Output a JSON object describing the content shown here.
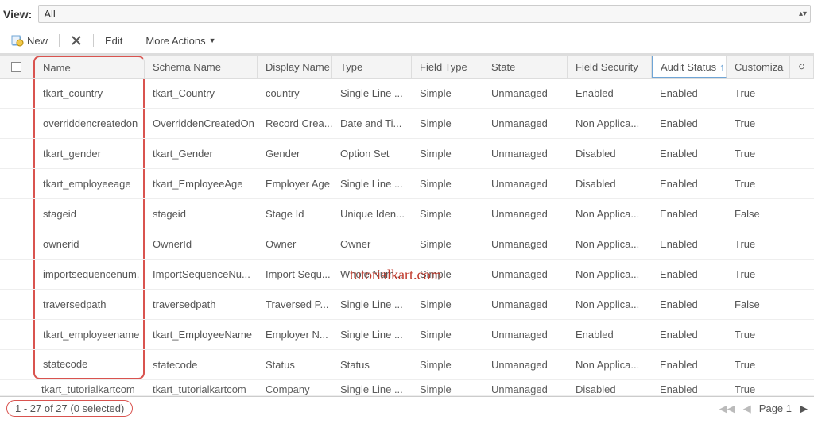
{
  "view": {
    "label": "View:",
    "value": "All"
  },
  "toolbar": {
    "new_label": "New",
    "edit_label": "Edit",
    "more_label": "More Actions"
  },
  "columns": {
    "checkbox": "",
    "name": "Name",
    "schema": "Schema Name",
    "display": "Display Name",
    "type": "Type",
    "field_type": "Field Type",
    "state": "State",
    "fs": "Field Security",
    "audit": "Audit Status",
    "customizable": "Customiza"
  },
  "sort_indicator": "↑",
  "rows": [
    {
      "name": "tkart_country",
      "schema": "tkart_Country",
      "display": "country",
      "type": "Single Line ...",
      "ft": "Simple",
      "state": "Unmanaged",
      "fs": "Enabled",
      "audit": "Enabled",
      "cust": "True"
    },
    {
      "name": "overriddencreatedon",
      "schema": "OverriddenCreatedOn",
      "display": "Record Crea...",
      "type": "Date and Ti...",
      "ft": "Simple",
      "state": "Unmanaged",
      "fs": "Non Applica...",
      "audit": "Enabled",
      "cust": "True"
    },
    {
      "name": "tkart_gender",
      "schema": "tkart_Gender",
      "display": "Gender",
      "type": "Option Set",
      "ft": "Simple",
      "state": "Unmanaged",
      "fs": "Disabled",
      "audit": "Enabled",
      "cust": "True"
    },
    {
      "name": "tkart_employeeage",
      "schema": "tkart_EmployeeAge",
      "display": "Employer Age",
      "type": "Single Line ...",
      "ft": "Simple",
      "state": "Unmanaged",
      "fs": "Disabled",
      "audit": "Enabled",
      "cust": "True"
    },
    {
      "name": "stageid",
      "schema": "stageid",
      "display": "Stage Id",
      "type": "Unique Iden...",
      "ft": "Simple",
      "state": "Unmanaged",
      "fs": "Non Applica...",
      "audit": "Enabled",
      "cust": "False"
    },
    {
      "name": "ownerid",
      "schema": "OwnerId",
      "display": "Owner",
      "type": "Owner",
      "ft": "Simple",
      "state": "Unmanaged",
      "fs": "Non Applica...",
      "audit": "Enabled",
      "cust": "True"
    },
    {
      "name": "importsequencenum.",
      "schema": "ImportSequenceNu...",
      "display": "Import Sequ...",
      "type": "Whole Num...",
      "ft": "Simple",
      "state": "Unmanaged",
      "fs": "Non Applica...",
      "audit": "Enabled",
      "cust": "True"
    },
    {
      "name": "traversedpath",
      "schema": "traversedpath",
      "display": "Traversed P...",
      "type": "Single Line ...",
      "ft": "Simple",
      "state": "Unmanaged",
      "fs": "Non Applica...",
      "audit": "Enabled",
      "cust": "False"
    },
    {
      "name": "tkart_employeename",
      "schema": "tkart_EmployeeName",
      "display": "Employer N...",
      "type": "Single Line ...",
      "ft": "Simple",
      "state": "Unmanaged",
      "fs": "Enabled",
      "audit": "Enabled",
      "cust": "True"
    },
    {
      "name": "statecode",
      "schema": "statecode",
      "display": "Status",
      "type": "Status",
      "ft": "Simple",
      "state": "Unmanaged",
      "fs": "Non Applica...",
      "audit": "Enabled",
      "cust": "True"
    }
  ],
  "partial_row": {
    "name": "tkart_tutorialkartcom",
    "schema": "tkart_tutorialkartcom",
    "display": "Company",
    "type": "Single Line ...",
    "ft": "Simple",
    "state": "Unmanaged",
    "fs": "Disabled",
    "audit": "Enabled",
    "cust": "True"
  },
  "footer": {
    "counter": "1 - 27 of 27 (0 selected)",
    "page_label": "Page 1"
  },
  "watermark": "tutorialkart.com"
}
